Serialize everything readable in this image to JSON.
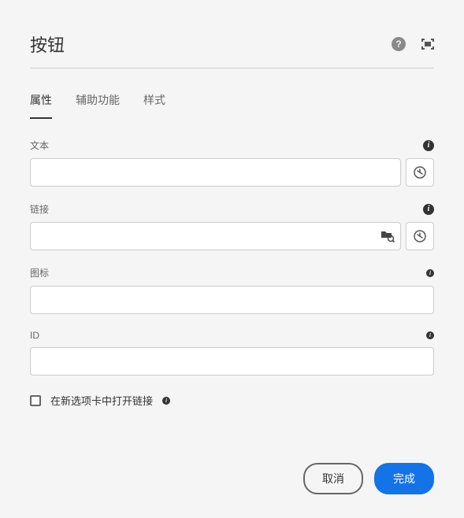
{
  "title": "按钮",
  "tabs": {
    "properties": "属性",
    "accessibility": "辅助功能",
    "styles": "样式"
  },
  "fields": {
    "text": {
      "label": "文本",
      "value": ""
    },
    "link": {
      "label": "链接",
      "value": ""
    },
    "icon": {
      "label": "图标",
      "value": ""
    },
    "id": {
      "label": "ID",
      "value": ""
    }
  },
  "checkbox": {
    "openNewTab": "在新选项卡中打开链接"
  },
  "footer": {
    "cancel": "取消",
    "done": "完成"
  }
}
